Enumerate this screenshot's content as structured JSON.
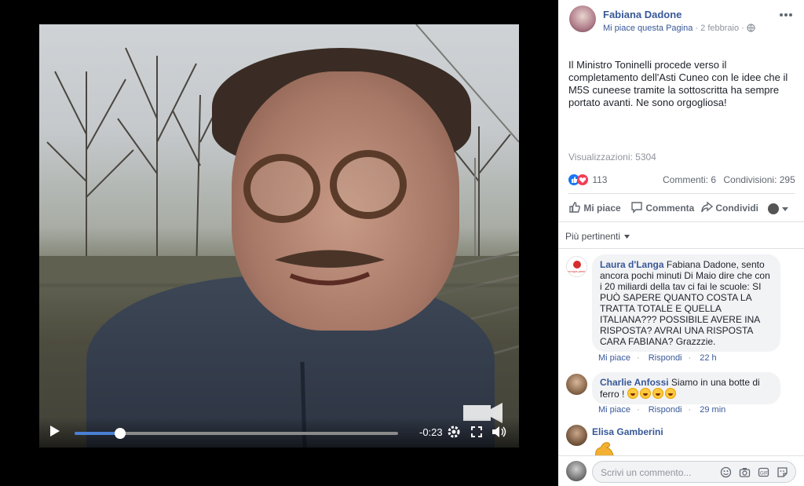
{
  "video": {
    "time_remaining": "-0:23",
    "progress": 0.14
  },
  "post": {
    "author": "Fabiana Dadone",
    "page_like": "Mi piace questa Pagina",
    "date": "2 febbraio",
    "text": "Il Ministro Toninelli procede verso il completamento dell'Asti Cuneo con le idee che il M5S cuneese tramite la sottoscritta ha sempre portato avanti. Ne sono orgogliosa!",
    "views": "Visualizzazioni: 5304",
    "reactions_count": "113",
    "comments_count": "Commenti: 6",
    "shares_count": "Condivisioni: 295",
    "like_label": "Mi piace",
    "comment_label": "Commenta",
    "share_label": "Condividi",
    "sort_label": "Più pertinenti"
  },
  "comments": [
    {
      "author": "Laura d'Langa",
      "text": "Fabiana Dadone, sento ancora pochi minuti Di Maio dire che con i 20 miliardi della tav ci fai le scuole: SI PUÒ SAPERE QUANTO COSTA LA TRATTA TOTALE E QUELLA ITALIANA??? POSSIBILE AVERE INA RISPOSTA? AVRAI UNA RISPOSTA CARA FABIANA? Grazzzie.",
      "like": "Mi piace",
      "reply": "Rispondi",
      "time": "22 h",
      "avatar_text": "europa press"
    },
    {
      "author": "Charlie Anfossi",
      "text": "Siamo in una botte di ferro !",
      "like": "Mi piace",
      "reply": "Rispondi",
      "time": "29 min"
    },
    {
      "author": "Elisa Gamberini",
      "text": ""
    }
  ],
  "composer": {
    "placeholder": "Scrivi un commento..."
  },
  "colors": {
    "link": "#385898",
    "muted": "#90949c",
    "bubble": "#f2f3f5",
    "progress": "#4a7fd4"
  }
}
